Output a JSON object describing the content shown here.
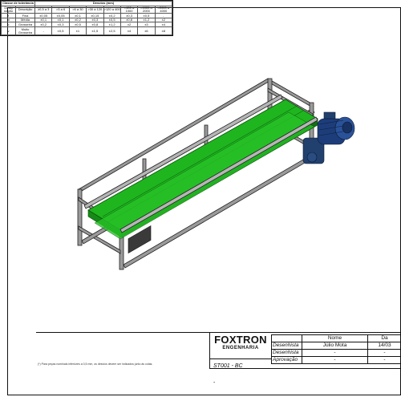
{
  "title_block": {
    "company": "FOXTRON",
    "company_sub": "ENGENHARIA",
    "code": "ST001 - BC",
    "dash": "-",
    "sign_headers": [
      "Nome",
      "Da"
    ],
    "sign_rows": [
      {
        "role": "Desenhista",
        "name": "Júlio Mota",
        "date": "14/03"
      },
      {
        "role": "Desenhista",
        "name": "-",
        "date": "-"
      },
      {
        "role": "Aprovação",
        "name": "-",
        "date": "-"
      }
    ]
  },
  "tolerance": {
    "class_header": "Classe de tolerância",
    "dims_header": "Desvios (mm)",
    "col_desig": "Desig nação",
    "col_desc": "Descrição",
    "ranges": [
      "≥0,5 a 3",
      ">3 a 6",
      ">6 a 30",
      ">30 a 120",
      ">120 a 400",
      ">400 a 1000",
      ">1000 a 2000",
      ">2000 a 4000"
    ],
    "rows": [
      {
        "desig": "f",
        "desc": "Fina",
        "vals": [
          "±0,05",
          "±0,05",
          "±0,1",
          "±0,15",
          "±0,2",
          "±0,3",
          "±0,5",
          "-"
        ]
      },
      {
        "desig": "m",
        "desc": "Média",
        "vals": [
          "±0,1",
          "±0,1",
          "±0,2",
          "±0,3",
          "±0,5",
          "±0,8",
          "±1,2",
          "±2"
        ]
      },
      {
        "desig": "c",
        "desc": "Grosseira",
        "vals": [
          "±0,2",
          "±0,3",
          "±0,5",
          "±0,8",
          "±1,2",
          "±2",
          "±3",
          "±4"
        ]
      },
      {
        "desig": "v",
        "desc": "Muito Grosseira",
        "vals": [
          "-",
          "±0,5",
          "±1",
          "±1,5",
          "±2,5",
          "±4",
          "±6",
          "±8"
        ]
      }
    ],
    "note": "(*) Para peças nominais inferiores a 0,5 mm, os desvios devem ser indicados junto às cotas."
  },
  "colors": {
    "belt": "#1fb51f",
    "frame_steel": "#8c8c8c",
    "motor": "#1d3d7a",
    "line": "#111111"
  }
}
